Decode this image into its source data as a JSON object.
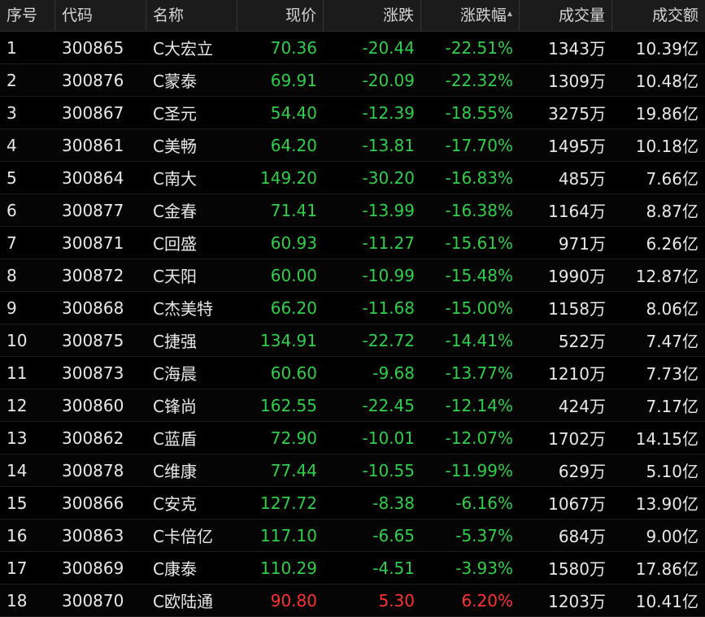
{
  "colors": {
    "down": "#2fcf4a",
    "up": "#ff3232",
    "text": "#e6e6e6",
    "header_bg": "#1b1b1b",
    "bg": "#000000"
  },
  "sort_icon": "sort-up-icon",
  "headers": [
    "序号",
    "代码",
    "名称",
    "现价",
    "涨跌",
    "涨跌幅",
    "成交量",
    "成交额"
  ],
  "rows": [
    [
      "1",
      "300865",
      "C大宏立",
      "70.36",
      "-20.44",
      "-22.51%",
      "1343万",
      "10.39亿"
    ],
    [
      "2",
      "300876",
      "C蒙泰",
      "69.91",
      "-20.09",
      "-22.32%",
      "1309万",
      "10.48亿"
    ],
    [
      "3",
      "300867",
      "C圣元",
      "54.40",
      "-12.39",
      "-18.55%",
      "3275万",
      "19.86亿"
    ],
    [
      "4",
      "300861",
      "C美畅",
      "64.20",
      "-13.81",
      "-17.70%",
      "1495万",
      "10.18亿"
    ],
    [
      "5",
      "300864",
      "C南大",
      "149.20",
      "-30.20",
      "-16.83%",
      "485万",
      "7.66亿"
    ],
    [
      "6",
      "300877",
      "C金春",
      "71.41",
      "-13.99",
      "-16.38%",
      "1164万",
      "8.87亿"
    ],
    [
      "7",
      "300871",
      "C回盛",
      "60.93",
      "-11.27",
      "-15.61%",
      "971万",
      "6.26亿"
    ],
    [
      "8",
      "300872",
      "C天阳",
      "60.00",
      "-10.99",
      "-15.48%",
      "1990万",
      "12.87亿"
    ],
    [
      "9",
      "300868",
      "C杰美特",
      "66.20",
      "-11.68",
      "-15.00%",
      "1158万",
      "8.06亿"
    ],
    [
      "10",
      "300875",
      "C捷强",
      "134.91",
      "-22.72",
      "-14.41%",
      "522万",
      "7.47亿"
    ],
    [
      "11",
      "300873",
      "C海晨",
      "60.60",
      "-9.68",
      "-13.77%",
      "1210万",
      "7.73亿"
    ],
    [
      "12",
      "300860",
      "C锋尚",
      "162.55",
      "-22.45",
      "-12.14%",
      "424万",
      "7.17亿"
    ],
    [
      "13",
      "300862",
      "C蓝盾",
      "72.90",
      "-10.01",
      "-12.07%",
      "1702万",
      "14.15亿"
    ],
    [
      "14",
      "300878",
      "C维康",
      "77.44",
      "-10.55",
      "-11.99%",
      "629万",
      "5.10亿"
    ],
    [
      "15",
      "300866",
      "C安克",
      "127.72",
      "-8.38",
      "-6.16%",
      "1067万",
      "13.90亿"
    ],
    [
      "16",
      "300863",
      "C卡倍亿",
      "117.10",
      "-6.65",
      "-5.37%",
      "684万",
      "9.00亿"
    ],
    [
      "17",
      "300869",
      "C康泰",
      "110.29",
      "-4.51",
      "-3.93%",
      "1580万",
      "17.86亿"
    ],
    [
      "18",
      "300870",
      "C欧陆通",
      "90.80",
      "5.30",
      "6.20%",
      "1203万",
      "10.41亿"
    ]
  ]
}
